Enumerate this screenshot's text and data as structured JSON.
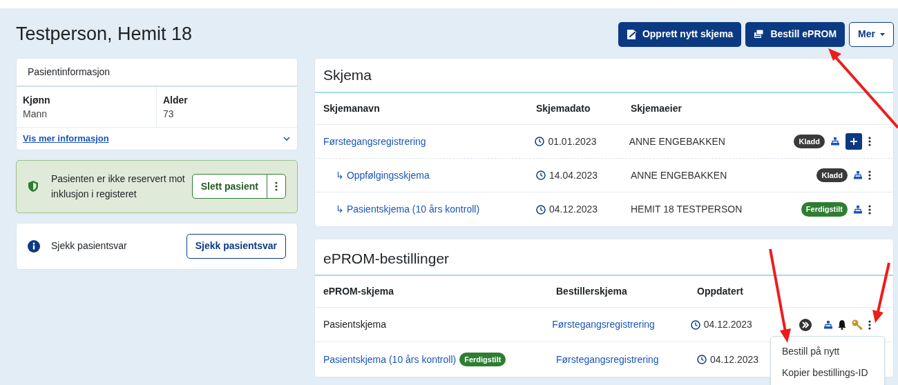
{
  "title": "Testperson, Hemit 18",
  "header_buttons": [
    {
      "label": "Opprett nytt skjema",
      "kind": "primary"
    },
    {
      "label": "Bestill ePROM",
      "kind": "primary"
    },
    {
      "label": "Mer",
      "kind": "dropdown"
    }
  ],
  "patient_info": {
    "title": "Pasientinformasjon",
    "fields": [
      {
        "label": "Kjønn",
        "value": "Mann"
      },
      {
        "label": "Alder",
        "value": "73"
      }
    ],
    "more_link": "Vis mer informasjon",
    "expanded": false
  },
  "reservation": {
    "text": "Pasienten er ikke reservert mot inklusjon i registeret",
    "button": "Slett pasient"
  },
  "check_answers": {
    "text": "Sjekk pasientsvar",
    "button": "Sjekk pasientsvar"
  },
  "schema": {
    "title": "Skjema",
    "columns": [
      "Skjemanavn",
      "Skjemadato",
      "Skjemaeier"
    ],
    "rows": [
      {
        "name": "Førstegangsregistrering",
        "date": "01.01.2023",
        "owner": "ANNE ENGEBAKKEN",
        "status": {
          "label": "Kladd",
          "kind": "draft"
        },
        "children": [
          {
            "name": "↳ Oppfølgingsskjema",
            "date": "14.04.2023",
            "owner": "ANNE ENGEBAKKEN",
            "status": {
              "label": "Kladd",
              "kind": "draft"
            }
          },
          {
            "name": "↳ Pasientskjema (10 års kontroll)",
            "date": "04.12.2023",
            "owner": "HEMIT 18 TESTPERSON",
            "status": {
              "label": "Ferdigstilt",
              "kind": "done"
            }
          }
        ]
      }
    ]
  },
  "eprom": {
    "title": "ePROM-bestillinger",
    "columns": [
      "ePROM-skjema",
      "Bestillerskjema",
      "Oppdatert"
    ],
    "rows": [
      {
        "name": "Pasientskjema",
        "order_form": "Førstegangsregistrering",
        "updated": "04.12.2023"
      },
      {
        "name": "Pasientskjema (10 års kontroll)",
        "status": {
          "label": "Ferdigstilt",
          "kind": "done"
        },
        "order_form": "Førstegangsregistrering",
        "updated": "04.12.2023"
      }
    ]
  },
  "context_menu": {
    "items": [
      "Bestill på nytt",
      "Kopier bestillings-ID"
    ]
  }
}
